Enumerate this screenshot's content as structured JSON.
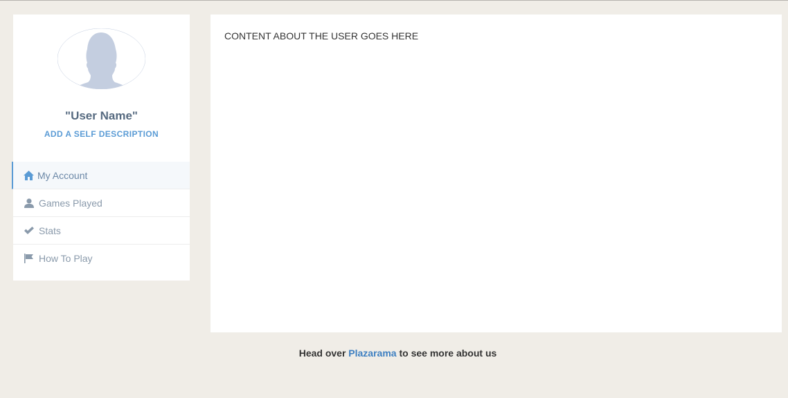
{
  "profile": {
    "user_name": "\"User Name\"",
    "self_description_link": "ADD A SELF DESCRIPTION"
  },
  "nav": {
    "items": [
      {
        "label": "My Account",
        "icon": "home-icon",
        "active": true
      },
      {
        "label": "Games Played",
        "icon": "user-icon",
        "active": false
      },
      {
        "label": "Stats",
        "icon": "check-icon",
        "active": false
      },
      {
        "label": "How To Play",
        "icon": "flag-icon",
        "active": false
      }
    ]
  },
  "main": {
    "content_text": "CONTENT ABOUT THE USER GOES HERE"
  },
  "footer": {
    "prefix": "Head over",
    "link": "Plazarama",
    "suffix": "to see more about us"
  },
  "colors": {
    "page_bg": "#f0ede7",
    "accent": "#5a9bd5",
    "avatar": "#c4cee0"
  }
}
